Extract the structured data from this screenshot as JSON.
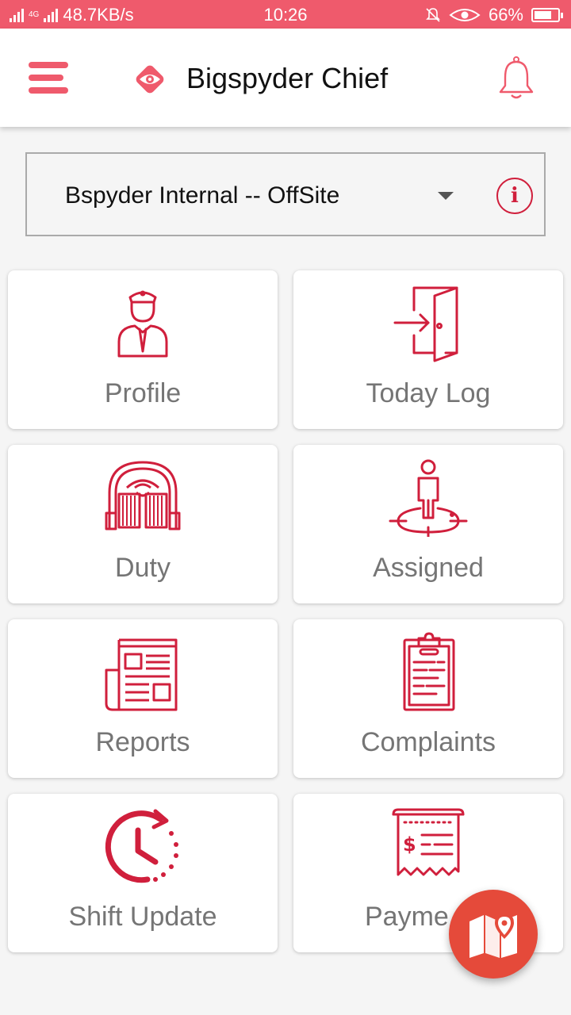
{
  "status_bar": {
    "network_tag": "4G",
    "speed": "48.7KB/s",
    "time": "10:26",
    "battery": "66%",
    "battery_level": 0.66
  },
  "app_bar": {
    "title": "Bigspyder Chief",
    "menu_icon": "hamburger-menu-icon",
    "logo_icon": "eye-diamond-logo",
    "notification_icon": "bell-icon",
    "accent_color": "#ef5a6c"
  },
  "site_selector": {
    "selected": "Bspyder Internal -- OffSite",
    "info_symbol": "i"
  },
  "tiles": [
    {
      "label": "Profile",
      "icon": "security-guard-icon"
    },
    {
      "label": "Today Log",
      "icon": "door-enter-icon"
    },
    {
      "label": "Duty",
      "icon": "gate-icon"
    },
    {
      "label": "Assigned",
      "icon": "person-target-icon"
    },
    {
      "label": "Reports",
      "icon": "newspaper-icon"
    },
    {
      "label": "Complaints",
      "icon": "clipboard-icon"
    },
    {
      "label": "Shift Update",
      "icon": "clock-rotate-icon"
    },
    {
      "label": "Payme",
      "icon": "receipt-icon"
    }
  ],
  "fab": {
    "icon": "map-icon",
    "color": "#e54a3a"
  },
  "icon_color": "#d01f3c"
}
